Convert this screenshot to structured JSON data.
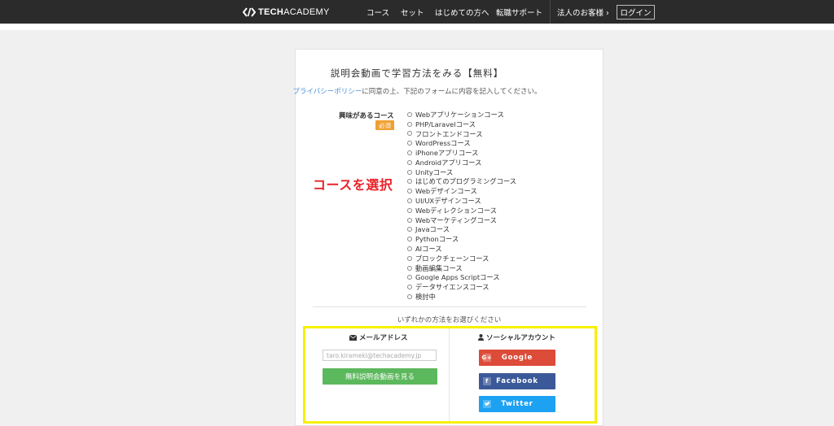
{
  "header": {
    "logo_tech": "TECH",
    "logo_academy": "ACADEMY",
    "nav": [
      "コース",
      "セット",
      "はじめての方へ",
      "転職サポート"
    ],
    "corporate": "法人のお客様 ›",
    "login": "ログイン"
  },
  "form": {
    "title": "説明会動画で学習方法をみる【無料】",
    "privacy_link": "プライバシーポリシー",
    "privacy_text": "に同意の上、下記のフォームに内容を記入してください。",
    "course_label": "興味があるコース",
    "required_badge": "必須",
    "annotation": "コースを選択",
    "courses": [
      "Webアプリケーションコース",
      "PHP/Laravelコース",
      "フロントエンドコース",
      "WordPressコース",
      "iPhoneアプリコース",
      "Androidアプリコース",
      "Unityコース",
      "はじめてのプログラミングコース",
      "Webデザインコース",
      "UI/UXデザインコース",
      "Webディレクションコース",
      "Webマーケティングコース",
      "Javaコース",
      "Pythonコース",
      "AIコース",
      "ブロックチェーンコース",
      "動画編集コース",
      "Google Apps Scriptコース",
      "データサイエンスコース",
      "検討中"
    ],
    "choose_method": "いずれかの方法をお選びください",
    "email_section": {
      "title": "メールアドレス",
      "placeholder": "taro.kirameki@techacademy.jp",
      "submit": "無料説明会動画を見る"
    },
    "social_section": {
      "title": "ソーシャルアカウント",
      "google": "Google",
      "facebook": "Facebook",
      "twitter": "Twitter"
    }
  },
  "colors": {
    "header_bg": "#2b2b2b",
    "link": "#4a90d9",
    "required": "#f0a030",
    "annotation": "#e8242a",
    "highlight": "#f7f000",
    "green": "#5cb85c",
    "google": "#dd4b39",
    "facebook": "#3b5998",
    "twitter": "#1da1f2"
  },
  "icons": {
    "logo": "brackets-logo-icon",
    "email": "envelope-icon",
    "social": "user-icon",
    "google": "google-plus-icon",
    "facebook": "facebook-icon",
    "twitter": "twitter-icon",
    "radio": "radio-icon"
  }
}
